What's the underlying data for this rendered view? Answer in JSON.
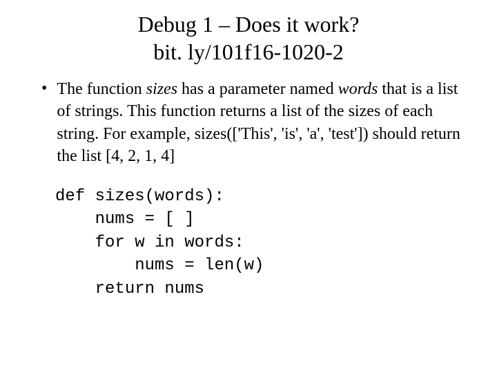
{
  "title": {
    "line1": "Debug 1 – Does it work?",
    "line2": "bit. ly/101f16-1020-2"
  },
  "bullet": {
    "marker": "•",
    "seg1": "The function ",
    "func_name": "sizes",
    "seg2": " has a parameter named ",
    "param_name": "words",
    "seg3": " that is a list of strings. This function returns a list of the sizes of each string. For example, sizes(['This', 'is', 'a', 'test']) should return the list [4, 2, 1, 4]"
  },
  "code": {
    "line1": "def sizes(words):",
    "line2": "    nums = [ ]",
    "line3": "    for w in words:",
    "line4": "        nums = len(w)",
    "line5": "    return nums"
  }
}
